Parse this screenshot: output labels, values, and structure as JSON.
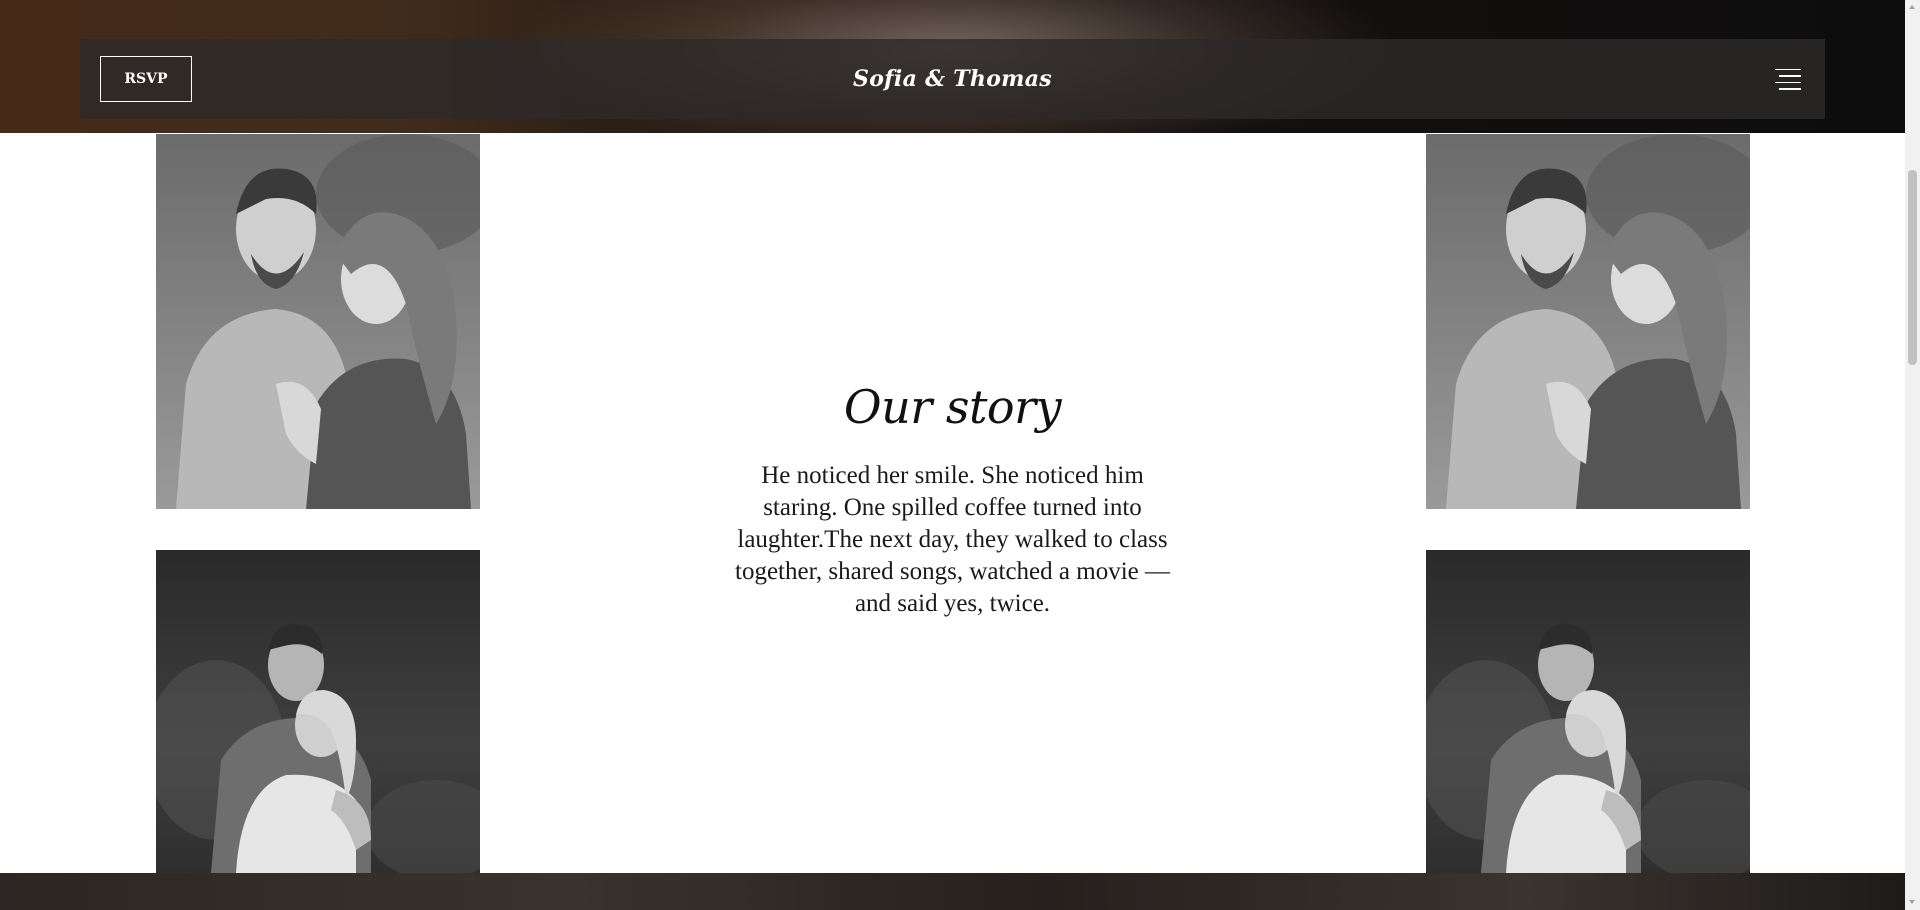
{
  "header": {
    "rsvp_label": "RSVP",
    "brand_title": "Sofia & Thomas",
    "menu_icon": "hamburger-menu-icon"
  },
  "story": {
    "title": "Our story",
    "text": "He noticed her smile. She noticed him staring. One spilled coffee turned into laughter.The next day, they walked to class together, shared songs, watched a movie — and said yes, twice."
  },
  "photos": [
    {
      "name": "couple-laughing-photo",
      "style": "grayscale"
    },
    {
      "name": "couple-laughing-photo",
      "style": "grayscale"
    },
    {
      "name": "couple-embrace-photo",
      "style": "grayscale"
    },
    {
      "name": "couple-embrace-photo",
      "style": "grayscale"
    }
  ],
  "colors": {
    "header_bg": "#2d2a2a",
    "text": "#111111",
    "accent": "#ffffff"
  }
}
